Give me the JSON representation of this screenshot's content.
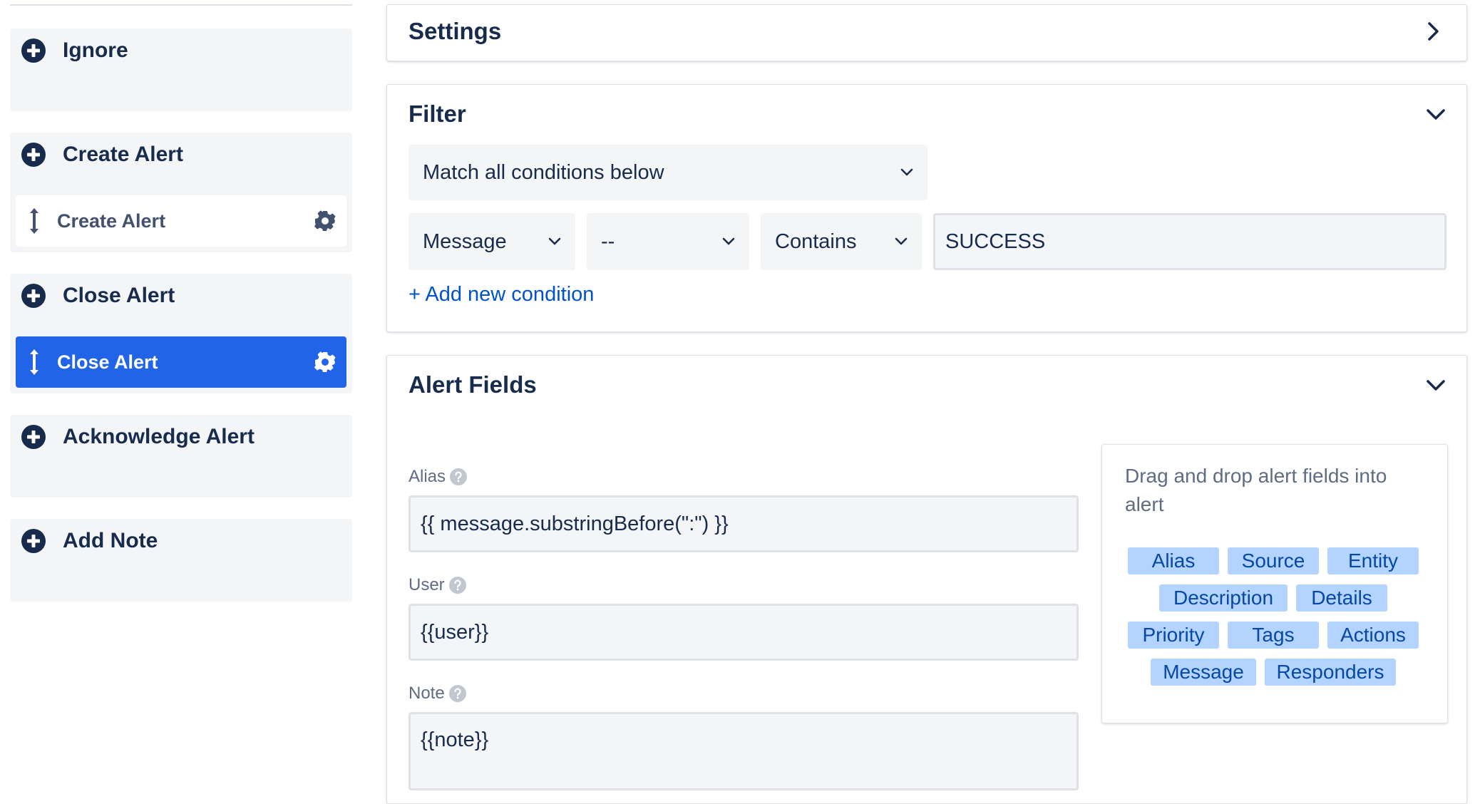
{
  "sidebar": {
    "groups": [
      {
        "title": "Ignore",
        "rules": []
      },
      {
        "title": "Create Alert",
        "rules": [
          {
            "label": "Create Alert",
            "active": false
          }
        ]
      },
      {
        "title": "Close Alert",
        "rules": [
          {
            "label": "Close Alert",
            "active": true
          }
        ]
      },
      {
        "title": "Acknowledge Alert",
        "rules": []
      },
      {
        "title": "Add Note",
        "rules": []
      }
    ],
    "active_color": "#2264e8"
  },
  "settings": {
    "title": "Settings"
  },
  "filter": {
    "title": "Filter",
    "match_mode": "Match all conditions below",
    "condition": {
      "field": "Message",
      "qualifier": "--",
      "operator": "Contains",
      "value": "SUCCESS"
    },
    "add_condition": "+ Add new condition"
  },
  "alert_fields": {
    "title": "Alert Fields",
    "fields": [
      {
        "label": "Alias",
        "value": "{{ message.substringBefore(\":\") }}"
      },
      {
        "label": "User",
        "value": "{{user}}"
      },
      {
        "label": "Note",
        "value": "{{note}}"
      }
    ],
    "drag_hint": "Drag and drop alert fields into alert",
    "chips": [
      "Alias",
      "Source",
      "Entity",
      "Description",
      "Details",
      "Priority",
      "Tags",
      "Actions",
      "Message",
      "Responders"
    ],
    "chip_color": "#b3d4ff"
  }
}
